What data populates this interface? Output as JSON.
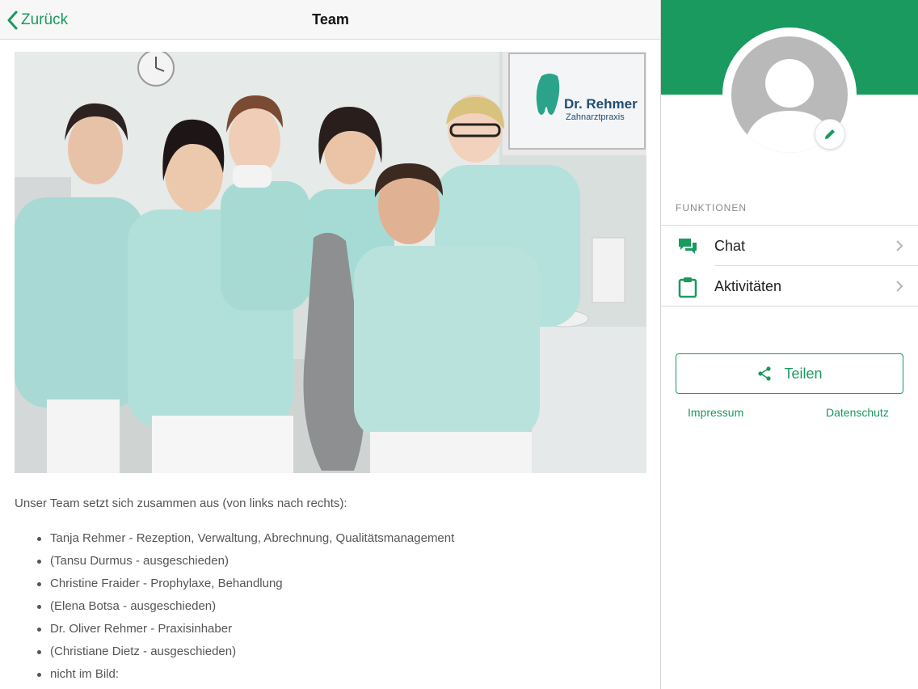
{
  "nav": {
    "back_label": "Zurück",
    "title": "Team"
  },
  "photo": {
    "sign_title": "Dr. Rehmer",
    "sign_subtitle": "Zahnarztpraxis"
  },
  "content": {
    "intro": "Unser Team setzt sich zusammen aus (von links nach rechts):",
    "members": [
      "Tanja Rehmer - Rezeption, Verwaltung, Abrechnung, Qualitätsmanagement",
      "(Tansu Durmus - ausgeschieden)",
      "Christine Fraider - Prophylaxe, Behandlung",
      "(Elena Botsa - ausgeschieden)",
      "Dr. Oliver Rehmer - Praxisinhaber",
      "(Christiane Dietz - ausgeschieden)",
      "nicht im Bild:"
    ]
  },
  "sidebar": {
    "section_label": "FUNKTIONEN",
    "items": [
      {
        "label": "Chat",
        "icon": "chat-icon"
      },
      {
        "label": "Aktivitäten",
        "icon": "clipboard-icon"
      }
    ],
    "share_label": "Teilen",
    "imprint_label": "Impressum",
    "privacy_label": "Datenschutz"
  },
  "colors": {
    "accent": "#1a9a5e",
    "avatar_gray": "#b9b9b9"
  }
}
